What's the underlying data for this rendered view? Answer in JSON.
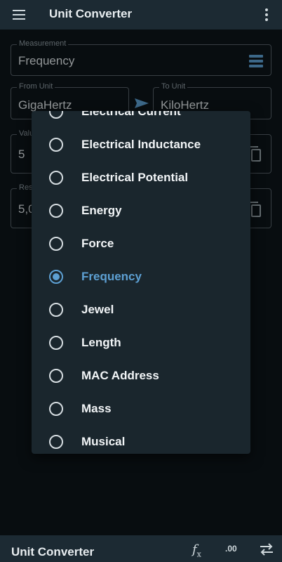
{
  "app": {
    "title": "Unit Converter"
  },
  "icons": {
    "menu": "hamburger-menu-icon",
    "more": "more-vert-icon",
    "list": "list-icon",
    "arrow": "send-arrow-icon",
    "copy": "copy-icon",
    "function": "function-icon",
    "decimals": "decimal-places-icon",
    "swap": "swap-icon"
  },
  "colors": {
    "accent": "#5da0d3",
    "appbar": "#1c2a33",
    "background": "#0d1519",
    "dialog": "#1a262d"
  },
  "measurement": {
    "label": "Measurement",
    "value": "Frequency"
  },
  "from_unit": {
    "label": "From Unit",
    "value": "GigaHertz"
  },
  "to_unit": {
    "label": "To Unit",
    "value": "KiloHertz"
  },
  "value_field": {
    "label": "Valu",
    "value": "5"
  },
  "result_field": {
    "label": "Res",
    "value": "5,0"
  },
  "dialog": {
    "partial_top": "Electrical Current",
    "options": [
      {
        "label": "Electrical Inductance",
        "selected": false
      },
      {
        "label": "Electrical Potential",
        "selected": false
      },
      {
        "label": "Energy",
        "selected": false
      },
      {
        "label": "Force",
        "selected": false
      },
      {
        "label": "Frequency",
        "selected": true
      },
      {
        "label": "Jewel",
        "selected": false
      },
      {
        "label": "Length",
        "selected": false
      },
      {
        "label": "MAC Address",
        "selected": false
      },
      {
        "label": "Mass",
        "selected": false
      },
      {
        "label": "Musical",
        "selected": false
      }
    ]
  },
  "bottom_bar": {
    "title": "Unit Converter",
    "fx_label": "f",
    "fx_sub": "x",
    "decimals_label": ".00"
  }
}
